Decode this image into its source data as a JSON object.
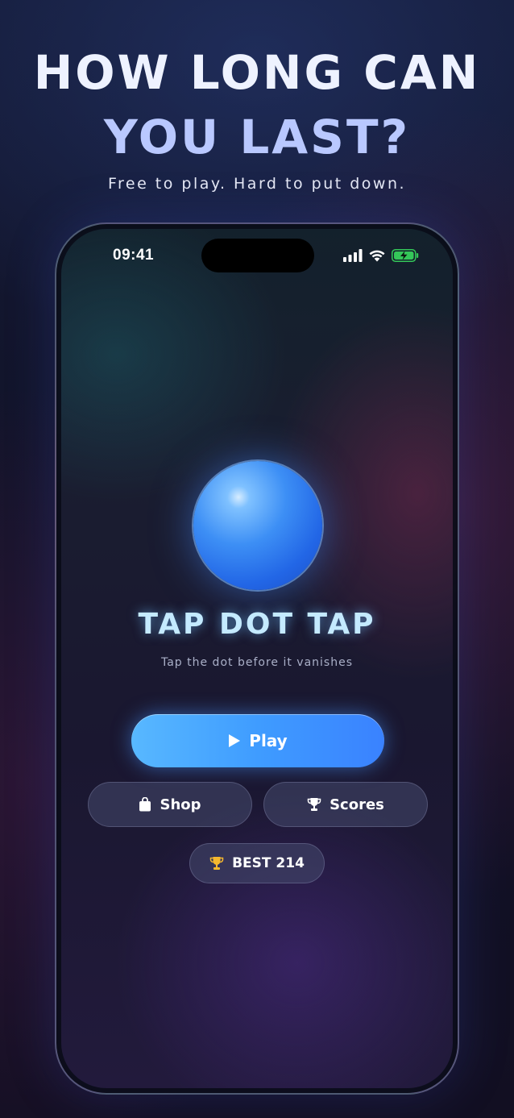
{
  "marketing": {
    "headline_line1": "HOW LONG CAN",
    "headline_line2": "YOU LAST?",
    "subheadline": "Free to play. Hard to put down."
  },
  "status_bar": {
    "time": "09:41",
    "icons": [
      "cellular-signal-icon",
      "wifi-icon",
      "battery-charging-icon"
    ]
  },
  "game": {
    "title": "TAP DOT TAP",
    "tagline": "Tap the dot before it vanishes",
    "dot_icon": "blue-sphere"
  },
  "buttons": {
    "play_label": "Play",
    "play_icon": "play-triangle-icon",
    "shop_label": "Shop",
    "shop_icon": "shopping-bag-icon",
    "scores_label": "Scores",
    "scores_icon": "trophy-icon"
  },
  "best": {
    "label": "BEST 214",
    "icon": "trophy-icon"
  },
  "colors": {
    "accent": "#3f9cff",
    "title_glow": "#c4eaff",
    "trophy": "#f5b82e",
    "battery": "#34c759"
  }
}
